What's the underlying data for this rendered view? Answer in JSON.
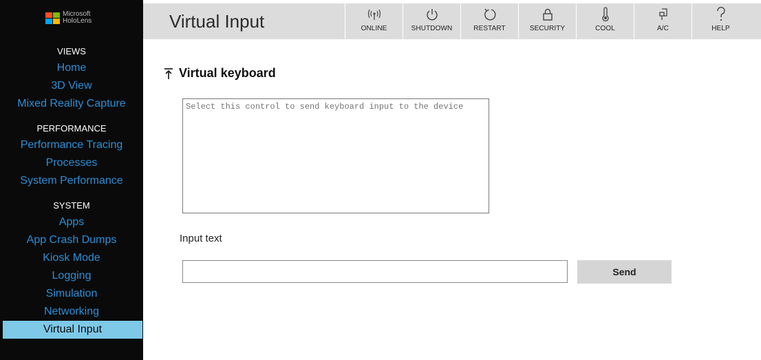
{
  "logo": {
    "text_line1": "Microsoft",
    "text_line2": "HoloLens",
    "colors": [
      "#f25022",
      "#7fba00",
      "#00a4ef",
      "#ffb900"
    ]
  },
  "sidebar": {
    "sections": [
      {
        "header": "VIEWS",
        "items": [
          "Home",
          "3D View",
          "Mixed Reality Capture"
        ]
      },
      {
        "header": "PERFORMANCE",
        "items": [
          "Performance Tracing",
          "Processes",
          "System Performance"
        ]
      },
      {
        "header": "SYSTEM",
        "items": [
          "Apps",
          "App Crash Dumps",
          "Kiosk Mode",
          "Logging",
          "Simulation",
          "Networking",
          "Virtual Input"
        ]
      }
    ],
    "active_item": "Virtual Input"
  },
  "header": {
    "title": "Virtual Input",
    "buttons": [
      {
        "label": "ONLINE",
        "icon": "online-icon"
      },
      {
        "label": "SHUTDOWN",
        "icon": "power-icon"
      },
      {
        "label": "RESTART",
        "icon": "restart-icon"
      },
      {
        "label": "SECURITY",
        "icon": "lock-icon"
      },
      {
        "label": "COOL",
        "icon": "thermometer-icon"
      },
      {
        "label": "A/C",
        "icon": "plug-icon"
      },
      {
        "label": "HELP",
        "icon": "question-icon"
      }
    ]
  },
  "main": {
    "section_title": "Virtual keyboard",
    "section_icon": "collapse-up-icon",
    "keyboard_placeholder": "Select this control to send keyboard input to the device",
    "input_label": "Input text",
    "input_value": "",
    "send_label": "Send"
  },
  "colors": {
    "sidebar_bg": "#0a0a0a",
    "nav_link": "#2b8fd6",
    "active_item_bg": "#7ec9e8",
    "topbar_bg": "#dcdcdc"
  }
}
